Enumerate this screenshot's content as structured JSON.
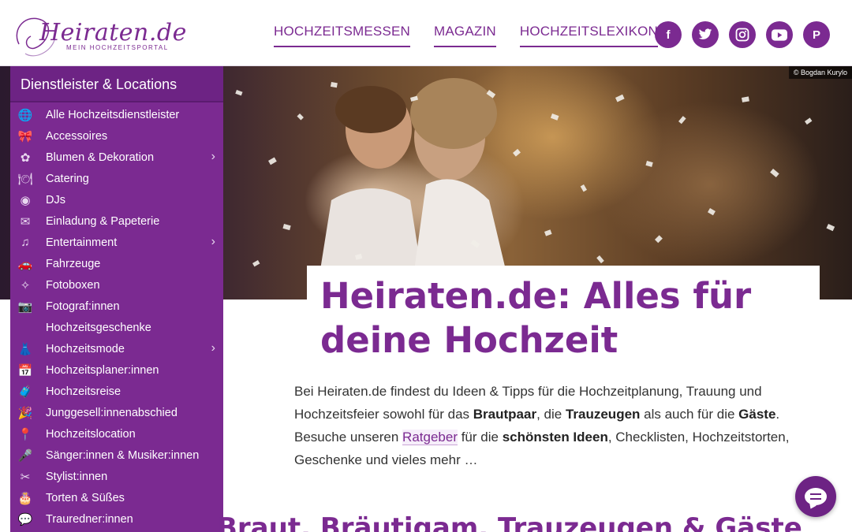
{
  "logo": {
    "brand": "Heiraten.de",
    "tagline": "MEIN HOCHZEITSPORTAL"
  },
  "nav": [
    {
      "label": "HOCHZEITSMESSEN"
    },
    {
      "label": "MAGAZIN"
    },
    {
      "label": "HOCHZEITSLEXIKON"
    }
  ],
  "socials": [
    {
      "icon": "facebook-icon",
      "glyph": "f"
    },
    {
      "icon": "twitter-icon",
      "glyph": "🐦"
    },
    {
      "icon": "instagram-icon",
      "glyph": "◎"
    },
    {
      "icon": "youtube-icon",
      "glyph": "▶"
    },
    {
      "icon": "pinterest-icon",
      "glyph": "P"
    }
  ],
  "hero": {
    "credit": "© Bogdan Kurylo"
  },
  "sidebar": {
    "title": "Dienstleister & Locations",
    "items": [
      {
        "label": "Alle Hochzeitsdienstleister",
        "icon": "globe-icon",
        "glyph": "🌐",
        "submenu": false
      },
      {
        "label": "Accessoires",
        "icon": "accessories-icon",
        "glyph": "🎀",
        "submenu": false
      },
      {
        "label": "Blumen & Dekoration",
        "icon": "flower-icon",
        "glyph": "✿",
        "submenu": true
      },
      {
        "label": "Catering",
        "icon": "catering-icon",
        "glyph": "🍽",
        "submenu": false
      },
      {
        "label": "DJs",
        "icon": "vinyl-icon",
        "glyph": "◉",
        "submenu": false
      },
      {
        "label": "Einladung & Papeterie",
        "icon": "envelope-icon",
        "glyph": "✉",
        "submenu": false
      },
      {
        "label": "Entertainment",
        "icon": "music-note-icon",
        "glyph": "♫",
        "submenu": true
      },
      {
        "label": "Fahrzeuge",
        "icon": "car-icon",
        "glyph": "🚗",
        "submenu": false
      },
      {
        "label": "Fotoboxen",
        "icon": "flash-icon",
        "glyph": "✧",
        "submenu": false
      },
      {
        "label": "Fotograf:innen",
        "icon": "camera-icon",
        "glyph": "📷",
        "submenu": false
      },
      {
        "label": "Hochzeitsgeschenke",
        "icon": "",
        "glyph": "",
        "submenu": false
      },
      {
        "label": "Hochzeitsmode",
        "icon": "dress-icon",
        "glyph": "👗",
        "submenu": true
      },
      {
        "label": "Hochzeitsplaner:innen",
        "icon": "calendar-icon",
        "glyph": "📅",
        "submenu": false
      },
      {
        "label": "Hochzeitsreise",
        "icon": "suitcase-icon",
        "glyph": "🧳",
        "submenu": false
      },
      {
        "label": "Junggesell:innenabschied",
        "icon": "party-icon",
        "glyph": "🎉",
        "submenu": false
      },
      {
        "label": "Hochzeitslocation",
        "icon": "location-pin-icon",
        "glyph": "📍",
        "submenu": false
      },
      {
        "label": "Sänger:innen & Musiker:innen",
        "icon": "microphone-icon",
        "glyph": "🎤",
        "submenu": false
      },
      {
        "label": "Stylist:innen",
        "icon": "hairdryer-icon",
        "glyph": "✂",
        "submenu": false
      },
      {
        "label": "Torten & Süßes",
        "icon": "cake-icon",
        "glyph": "🎂",
        "submenu": false
      },
      {
        "label": "Trauredner:innen",
        "icon": "speech-icon",
        "glyph": "💬",
        "submenu": false
      }
    ]
  },
  "main": {
    "title": "Heiraten.de: Alles für deine Hochzeit",
    "intro": {
      "p1": "Bei Heiraten.de findest du Ideen & Tipps für die Hochzeitplanung, Trauung und Hochzeitsfeier sowohl für das ",
      "b1": "Brautpaar",
      "p2": ", die ",
      "b2": "Trauzeugen",
      "p3": " als auch für die ",
      "b3": "Gäste",
      "p4": ". Besuche unseren ",
      "link": "Ratgeber",
      "p5": " für die ",
      "b4": "schönsten Ideen",
      "p6": ", Checklisten, Hochzeitstorten, Geschenke und vieles mehr …"
    },
    "subhead": "Braut, Bräutigam, Trauzeugen & Gäste"
  },
  "colors": {
    "brand": "#7b2a91",
    "brand_dark": "#6d2384"
  }
}
